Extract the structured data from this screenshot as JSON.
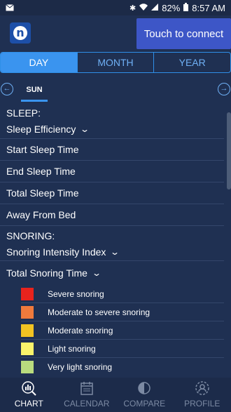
{
  "status": {
    "left_icon": "mail-icon",
    "battery": "82%",
    "time": "8:57 AM",
    "icons": [
      "bluetooth-icon",
      "wifi-icon",
      "signal-icon",
      "battery-icon"
    ]
  },
  "header": {
    "logo_letter": "n",
    "connect_label": "Touch to connect"
  },
  "tabs": [
    {
      "label": "DAY",
      "active": true
    },
    {
      "label": "MONTH",
      "active": false
    },
    {
      "label": "YEAR",
      "active": false
    }
  ],
  "day_nav": {
    "day": "SUN"
  },
  "sleep": {
    "title": "SLEEP:",
    "metric": "Sleep Efficiency",
    "items": [
      "Start Sleep Time",
      "End Sleep Time",
      "Total Sleep Time",
      "Away From Bed"
    ]
  },
  "snoring": {
    "title": "SNORING:",
    "metric": "Snoring Intensity Index",
    "total_label": "Total Snoring Time",
    "legend": [
      {
        "label": "Severe snoring",
        "color": "#e8231d"
      },
      {
        "label": "Moderate to severe snoring",
        "color": "#f07a3c"
      },
      {
        "label": "Moderate snoring",
        "color": "#f2c322"
      },
      {
        "label": "Light snoring",
        "color": "#f9f36b"
      },
      {
        "label": "Very light snoring",
        "color": "#b9dc7e"
      }
    ]
  },
  "bottom_nav": [
    {
      "label": "CHART",
      "icon": "chart-icon",
      "active": true
    },
    {
      "label": "CALENDAR",
      "icon": "calendar-icon",
      "active": false
    },
    {
      "label": "COMPARE",
      "icon": "compare-icon",
      "active": false
    },
    {
      "label": "PROFILE",
      "icon": "profile-icon",
      "active": false
    }
  ]
}
